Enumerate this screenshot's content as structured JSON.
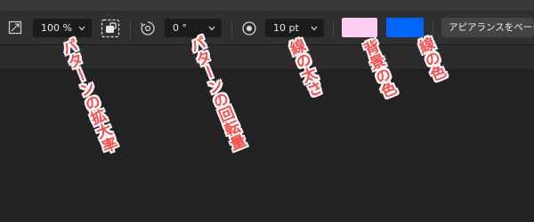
{
  "toolbar": {
    "scale_value": "100 %",
    "rotation_value": "0 °",
    "stroke_width_value": "10 pt",
    "background_color": "#ffccf2",
    "stroke_color": "#0066ff",
    "appearance_button_label": "アピアランスをベーク"
  },
  "icons": {
    "scale": "scale-icon",
    "pattern_tile": "pattern-tile-icon",
    "rotate": "rotate-icon",
    "stroke": "stroke-width-icon",
    "chevron": "chevron-down-icon"
  },
  "annotations": {
    "pattern_scale": "パターンの拡大率",
    "pattern_rotation": "パターンの回転量",
    "stroke_width": "線の太さ",
    "background_color": "背景の色",
    "stroke_color": "線の色"
  }
}
